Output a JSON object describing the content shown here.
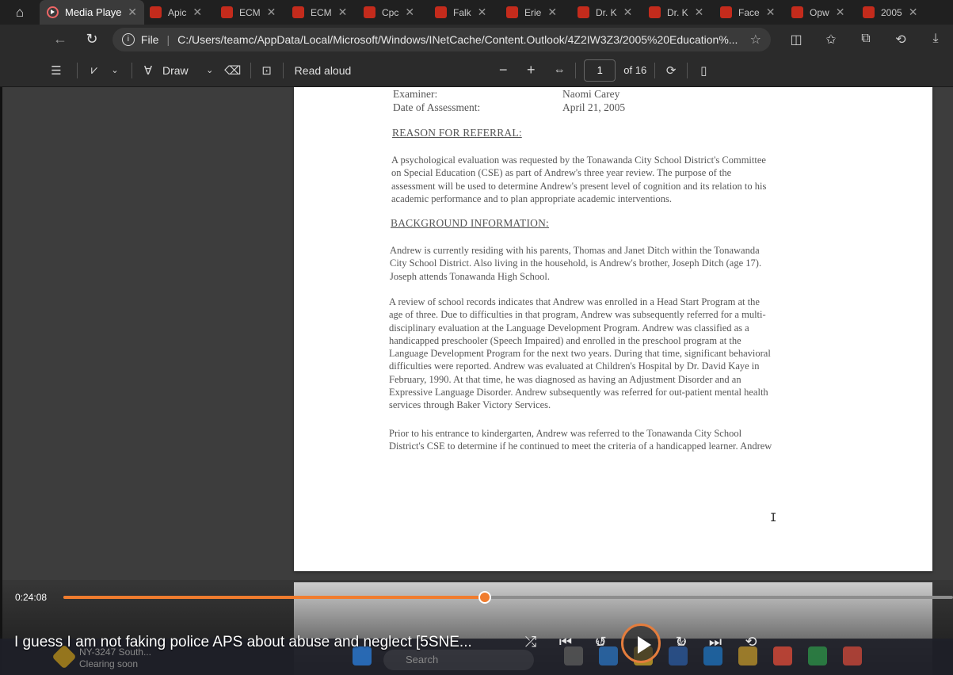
{
  "browser": {
    "tabs": [
      {
        "label": "Media Player",
        "active": true
      },
      {
        "label": "Apic"
      },
      {
        "label": "ECM"
      },
      {
        "label": "ECM"
      },
      {
        "label": "Cpc"
      },
      {
        "label": "Falk"
      },
      {
        "label": "Erie"
      },
      {
        "label": "Dr. K"
      },
      {
        "label": "Dr. K"
      },
      {
        "label": "Face"
      },
      {
        "label": "Opw"
      },
      {
        "label": "2005"
      }
    ],
    "address": {
      "scheme": "File",
      "url": "C:/Users/teamc/AppData/Local/Microsoft/Windows/INetCache/Content.Outlook/4Z2IW3Z3/2005%20Education%..."
    }
  },
  "pdf_toolbar": {
    "draw_label": "Draw",
    "read_aloud_label": "Read aloud",
    "page_number": "1",
    "page_total": "of 16"
  },
  "document": {
    "examiner_label": "Examiner:",
    "examiner_value": "Naomi Carey",
    "date_label": "Date of Assessment:",
    "date_value": "April 21, 2005",
    "heading_referral": "REASON FOR REFERRAL:",
    "referral_lines": [
      "A psychological evaluation was requested by the Tonawanda City School District's Committee",
      "on Special Education (CSE) as part of Andrew's three year review. The purpose of the",
      "assessment will be used to determine Andrew's present level of cognition and its relation to his",
      "academic performance and to plan appropriate academic interventions."
    ],
    "heading_background": "BACKGROUND INFORMATION:",
    "background_p1": [
      "Andrew is currently residing with his parents, Thomas and Janet Ditch within the Tonawanda",
      "City School District.  Also living in the household, is Andrew's brother, Joseph Ditch (age 17).",
      "Joseph attends Tonawanda High School."
    ],
    "background_p2": [
      "A review of school records indicates that Andrew was enrolled in a Head Start Program at the",
      "age of three.  Due to difficulties in that program, Andrew was subsequently referred for a multi-",
      "disciplinary evaluation at the Language Development Program.  Andrew was classified as a",
      "handicapped preschooler (Speech Impaired) and enrolled in the preschool program at the",
      "Language Development Program for the next two years.  During that time, significant behavioral",
      "difficulties were reported. Andrew was evaluated at Children's Hospital by Dr. David Kaye in",
      "February, 1990.  At that time, he was diagnosed as having an Adjustment Disorder and an",
      "Expressive Language Disorder.  Andrew subsequently was referred for out-patient mental health",
      "services through Baker Victory Services."
    ],
    "background_p3": [
      "Prior to his entrance to kindergarten, Andrew was referred to the Tonawanda City School",
      "District's CSE to determine if he continued to meet the criteria of a handicapped learner. Andrew"
    ]
  },
  "media": {
    "elapsed": "0:24:08",
    "progress_fraction": 0.474,
    "title": "I guess I am not faking police APS about abuse and neglect [5SNE...",
    "skip_back_seconds": "10",
    "skip_forward_seconds": "30"
  },
  "taskbar": {
    "weather_title": "NY-3247 South...",
    "weather_sub": "Clearing soon",
    "search_label": "Search"
  }
}
